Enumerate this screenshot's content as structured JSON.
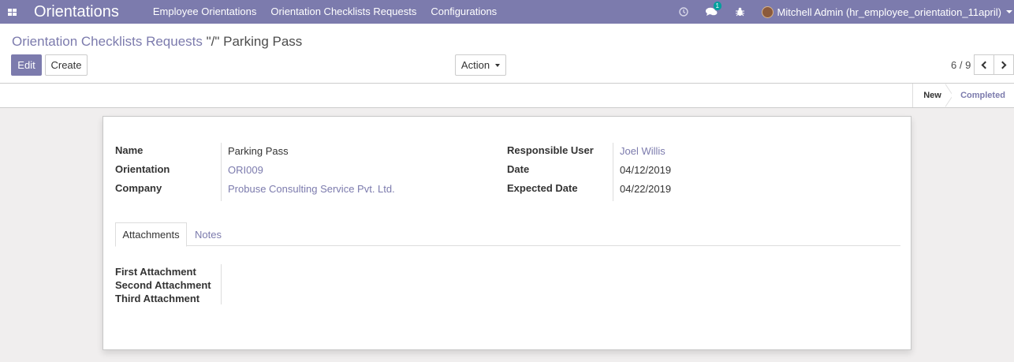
{
  "navbar": {
    "brand": "Orientations",
    "menu": [
      "Employee Orientations",
      "Orientation Checklists Requests",
      "Configurations"
    ],
    "messages_badge": "1",
    "user_name": "Mitchell Admin (hr_employee_orientation_11april)"
  },
  "breadcrumb": {
    "parent": "Orientation Checklists Requests",
    "separator": " \"/\" ",
    "current": "Parking Pass"
  },
  "buttons": {
    "edit": "Edit",
    "create": "Create",
    "action": "Action"
  },
  "pager": {
    "value": "6 / 9"
  },
  "statusbar": {
    "stages": [
      "New",
      "Completed"
    ],
    "current": "New"
  },
  "form": {
    "name_label": "Name",
    "name_value": "Parking Pass",
    "orientation_label": "Orientation",
    "orientation_value": "ORI009",
    "company_label": "Company",
    "company_value": "Probuse Consulting Service Pvt. Ltd.",
    "responsible_label": "Responsible User",
    "responsible_value": "Joel Willis",
    "date_label": "Date",
    "date_value": "04/12/2019",
    "expected_label": "Expected Date",
    "expected_value": "04/22/2019"
  },
  "tabs": [
    "Attachments",
    "Notes"
  ],
  "attachments": {
    "first_label": "First Attachment",
    "second_label": "Second Attachment",
    "third_label": "Third Attachment"
  },
  "colors": {
    "navbar": "#7c7bad",
    "link": "#7c7bad",
    "badge": "#00a09d"
  }
}
